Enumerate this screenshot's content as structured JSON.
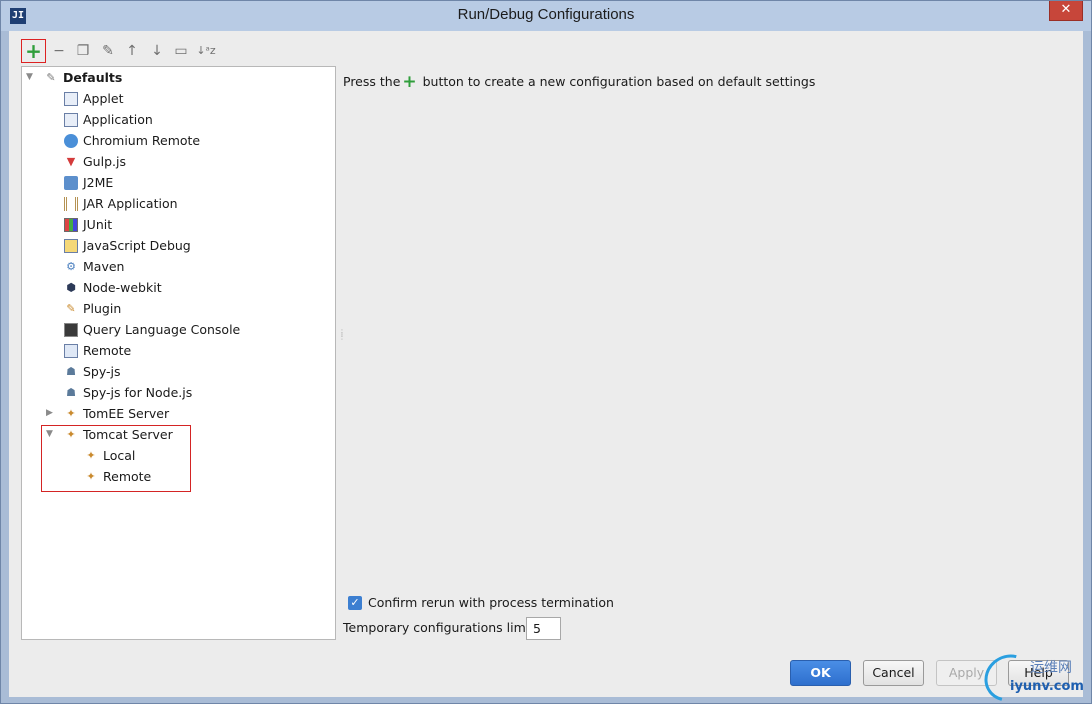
{
  "window": {
    "title": "Run/Debug Configurations",
    "app_icon_text": "JI",
    "close_glyph": "✕"
  },
  "toolbar": {
    "add": "+",
    "remove": "−",
    "copy": "❐",
    "edit_defaults": "✎",
    "move_up": "↑",
    "move_down": "↓",
    "folder": "▭",
    "sort": "↓ᵃz"
  },
  "tree": {
    "root_label": "Defaults",
    "items": [
      {
        "label": "Applet",
        "icon": "applet-icon"
      },
      {
        "label": "Application",
        "icon": "application-icon"
      },
      {
        "label": "Chromium Remote",
        "icon": "chromium-icon"
      },
      {
        "label": "Gulp.js",
        "icon": "gulp-icon"
      },
      {
        "label": "J2ME",
        "icon": "j2me-icon"
      },
      {
        "label": "JAR Application",
        "icon": "jar-icon"
      },
      {
        "label": "JUnit",
        "icon": "junit-icon"
      },
      {
        "label": "JavaScript Debug",
        "icon": "javascript-debug-icon"
      },
      {
        "label": "Maven",
        "icon": "maven-icon"
      },
      {
        "label": "Node-webkit",
        "icon": "node-webkit-icon"
      },
      {
        "label": "Plugin",
        "icon": "plugin-icon"
      },
      {
        "label": "Query Language Console",
        "icon": "query-console-icon"
      },
      {
        "label": "Remote",
        "icon": "remote-icon"
      },
      {
        "label": "Spy-js",
        "icon": "spy-js-icon"
      },
      {
        "label": "Spy-js for Node.js",
        "icon": "spy-js-node-icon"
      },
      {
        "label": "TomEE Server",
        "icon": "tomee-icon"
      },
      {
        "label": "Tomcat Server",
        "icon": "tomcat-icon"
      }
    ],
    "tomcat_children": [
      {
        "label": "Local",
        "icon": "tomcat-icon"
      },
      {
        "label": "Remote",
        "icon": "tomcat-icon"
      }
    ]
  },
  "main": {
    "hint_before": "Press the",
    "hint_plus": "+",
    "hint_after": " button to create a new configuration based on default settings",
    "confirm_label": "Confirm rerun with process termination",
    "confirm_checked": true,
    "limit_label": "Temporary configurations limit:",
    "limit_value": "5"
  },
  "buttons": {
    "ok": "OK",
    "cancel": "Cancel",
    "apply": "Apply",
    "help": "Help"
  },
  "watermark": {
    "line1": "运维网",
    "line2": "iyunv.com"
  },
  "colors": {
    "accent_green": "#2f9e3b",
    "ok_blue": "#2e6fcd",
    "highlight_red": "#d42424"
  }
}
